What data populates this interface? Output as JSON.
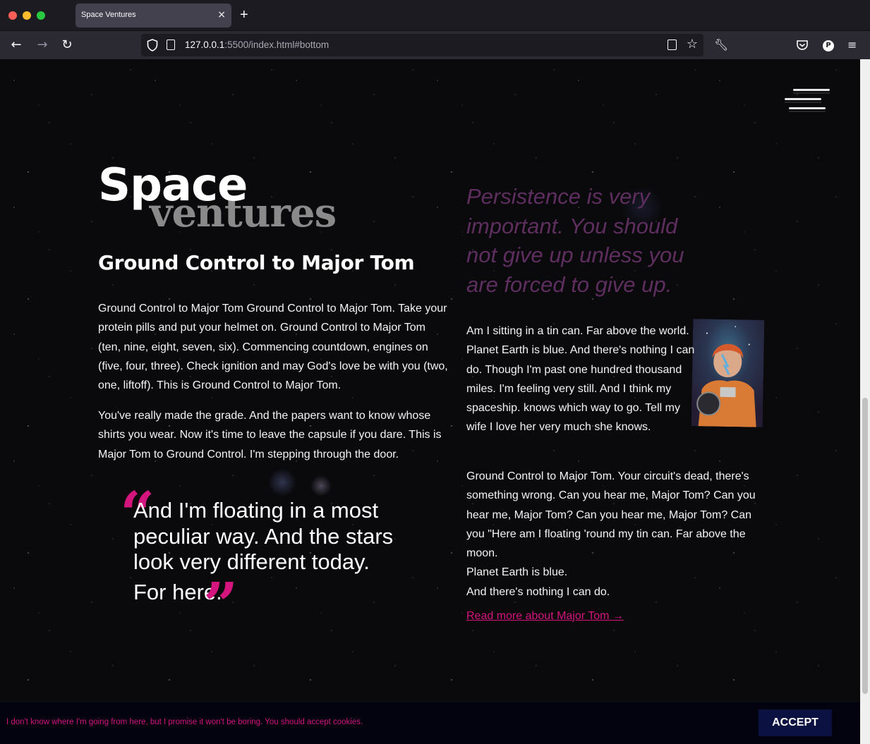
{
  "browser": {
    "tab_title": "Space Ventures",
    "tab_close": "×",
    "new_tab": "+",
    "url_host": "127.0.0.1",
    "url_rest": ":5500/index.html#bottom",
    "profile_initial": "P"
  },
  "logo": {
    "primary": "Space",
    "secondary": "ventures"
  },
  "main": {
    "heading": "Ground Control to Major Tom",
    "paragraph_1": "Ground Control to Major Tom Ground Control to Major Tom. Take your protein pills and put your helmet on. Ground Control to Major Tom (ten, nine, eight, seven, six). Commencing countdown, engines on (five, four, three). Check ignition and may God's love be with you (two, one, liftoff). This is Ground Control to Major Tom.",
    "paragraph_2": "You've really made the grade. And the papers want to know whose shirts you wear. Now it's time to leave the capsule if you dare. This is Major Tom to Ground Control. I'm stepping through the door.",
    "quote_open_mark": "“",
    "quote_text": "And I'm floating in a most peculiar way. And the stars look very different today.",
    "quote_last": "For here.",
    "quote_close_mark": "”"
  },
  "aside": {
    "pull_quote": "Persistence is very important. You should not give up unless you are forced to give up.",
    "paragraph_3": "Am I sitting in a tin can. Far above the world. Planet Earth is blue. And there's nothing I can do. Though I'm past one hundred thousand miles. I'm feeling very still. And I think my spaceship. knows which way to go. Tell my wife I love her very much she knows.",
    "paragraph_4": "Ground Control to Major Tom. Your circuit's dead, there's something wrong. Can you hear me, Major Tom? Can you hear me, Major Tom? Can you hear me, Major Tom? Can you \"Here am I floating 'round my tin can. Far above the moon.",
    "line_1": "Planet Earth is blue.",
    "line_2": "And there's nothing I can do.",
    "read_more": "Read more about Major Tom"
  },
  "cookie": {
    "message": "I don't know where I'm going from here, but I promise it won't be boring. You should accept cookies.",
    "accept": "ACCEPT"
  },
  "colors": {
    "accent": "#d4157e",
    "pull_quote": "#5e2e5f",
    "cookie_button": "#0b1140"
  }
}
